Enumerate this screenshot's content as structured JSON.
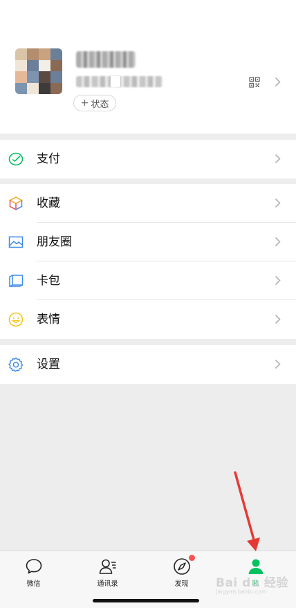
{
  "profile": {
    "status_plus": "+",
    "status_label": "状态"
  },
  "menu": {
    "pay": "支付",
    "favorites": "收藏",
    "moments": "朋友圈",
    "cards": "卡包",
    "stickers": "表情",
    "settings": "设置"
  },
  "tabs": [
    {
      "label": "微信",
      "icon": "chat-bubble-icon"
    },
    {
      "label": "通讯录",
      "icon": "contacts-icon"
    },
    {
      "label": "发现",
      "icon": "compass-icon",
      "badge": true
    },
    {
      "label": "我",
      "icon": "person-icon",
      "active": true
    }
  ],
  "watermark": {
    "brand": "Bai du 经验",
    "url": "jingyan.baidu.com"
  },
  "colors": {
    "accent": "#07c160",
    "badge": "#fa5151",
    "annotation_arrow": "#e53935",
    "background": "#ededed"
  }
}
